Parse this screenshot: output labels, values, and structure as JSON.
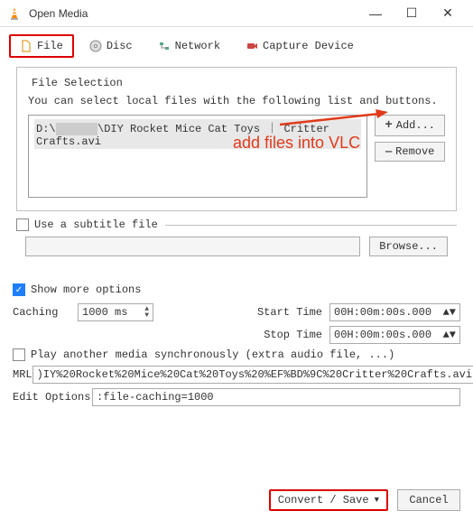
{
  "window": {
    "title": "Open Media"
  },
  "tabs": {
    "file": "File",
    "disc": "Disc",
    "network": "Network",
    "capture": "Capture Device"
  },
  "fileSelection": {
    "legend": "File Selection",
    "desc": "You can select local files with the following list and buttons.",
    "filePrefix": "D:\\",
    "fileName": "\\DIY Rocket Mice Cat Toys ｜ Critter Crafts.avi",
    "addLabel": "Add...",
    "removeLabel": "Remove"
  },
  "subtitle": {
    "label": "Use a subtitle file",
    "browse": "Browse..."
  },
  "showMore": {
    "label": "Show more options"
  },
  "options": {
    "cachingLabel": "Caching",
    "cachingValue": "1000 ms",
    "startLabel": "Start Time",
    "startValue": "00H:00m:00s.000",
    "stopLabel": "Stop Time",
    "stopValue": "00H:00m:00s.000",
    "syncLabel": "Play another media synchronously (extra audio file, ...)",
    "mrlLabel": "MRL",
    "mrlValue": ")IY%20Rocket%20Mice%20Cat%20Toys%20%EF%BD%9C%20Critter%20Crafts.avi",
    "editLabel": "Edit Options",
    "editValue": ":file-caching=1000"
  },
  "bottom": {
    "convert": "Convert / Save",
    "cancel": "Cancel"
  },
  "annotation": {
    "text": "add files into VLC"
  }
}
